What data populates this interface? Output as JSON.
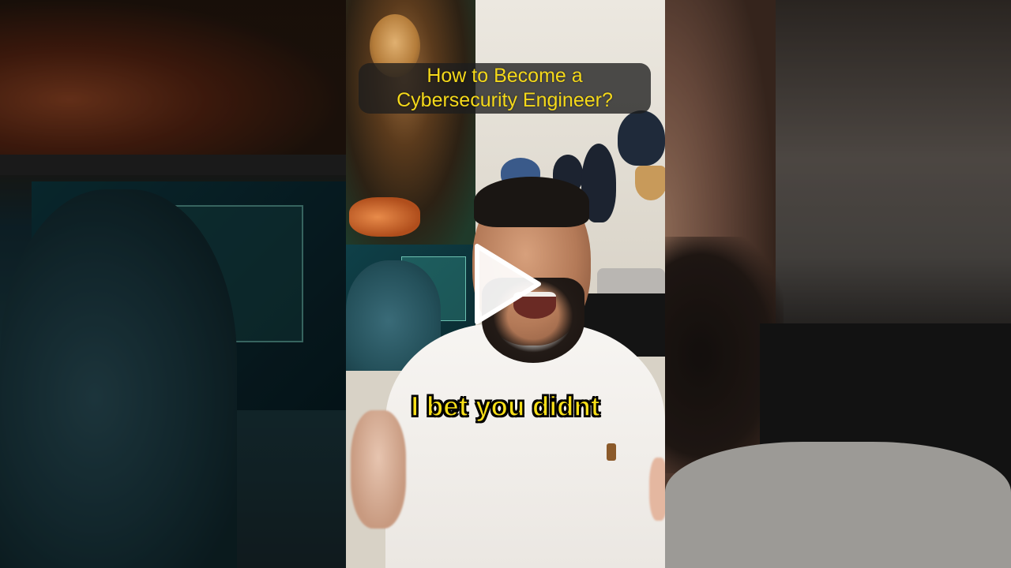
{
  "video": {
    "title_lines": [
      "How to Become a",
      "Cybersecurity Engineer?"
    ],
    "subtitle": "I bet you didnt"
  },
  "controls": {
    "play_icon": "play-icon"
  },
  "colors": {
    "caption_text": "#f5d91a",
    "caption_bg": "#1e1e1e",
    "subtitle_text": "#f7df18",
    "subtitle_outline": "#000000",
    "play_icon": "#ffffff"
  }
}
